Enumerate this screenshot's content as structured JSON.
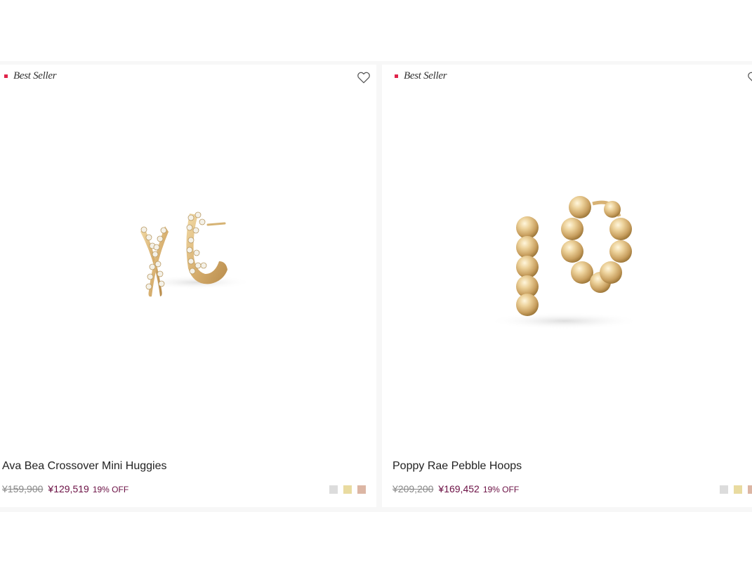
{
  "products": [
    {
      "badge": "Best Seller",
      "name": "Ava Bea Crossover Mini Huggies",
      "price_original": "¥159,900",
      "price_sale": "¥129,519",
      "discount": "19% OFF",
      "swatches": [
        "#dcdcdc",
        "#e9dba0",
        "#dcb6a4"
      ]
    },
    {
      "badge": "Best Seller",
      "name": "Poppy Rae Pebble Hoops",
      "price_original": "¥209,200",
      "price_sale": "¥169,452",
      "discount": "19% OFF",
      "swatches": [
        "#dcdcdc",
        "#e9dba0",
        "#dcb6a4"
      ]
    }
  ],
  "colors": {
    "badge_dot": "#e0234a",
    "sale_price": "#6b1044",
    "page_bg": "#f7f7f7"
  },
  "icons": {
    "wishlist": "heart-outline-icon"
  }
}
